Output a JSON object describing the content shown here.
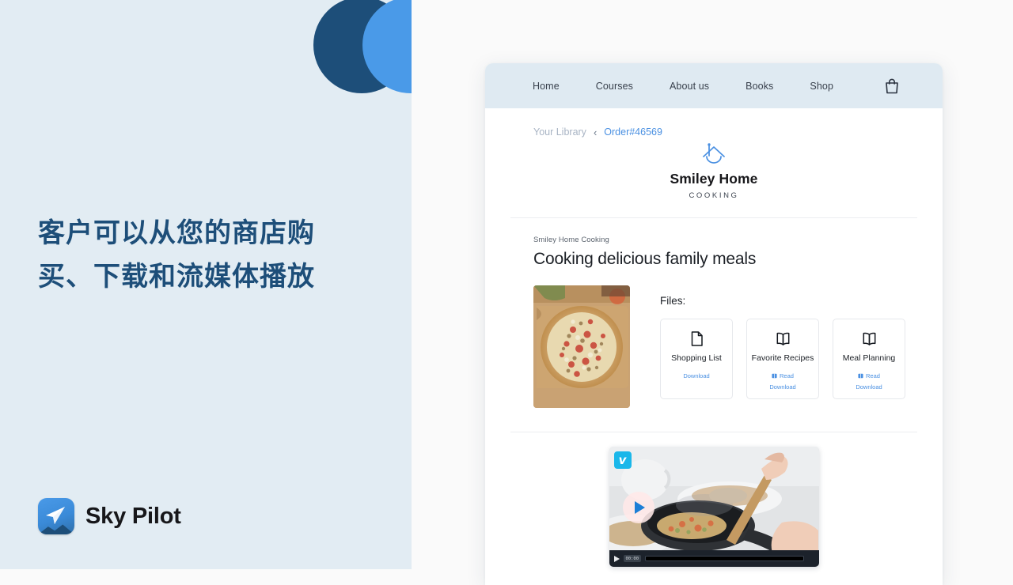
{
  "left_panel": {
    "headline": "客户可以从您的商店购买、下载和流媒体播放",
    "brand_name": "Sky Pilot",
    "logo_icon": "paper-plane-icon",
    "colors": {
      "background": "#e2ecf3",
      "headline": "#1d4e79",
      "circle_dark": "#1d4e79",
      "circle_light": "#4a9ae8"
    }
  },
  "browser": {
    "nav": {
      "items": [
        {
          "label": "Home"
        },
        {
          "label": "Courses"
        },
        {
          "label": "About us"
        },
        {
          "label": "Books"
        },
        {
          "label": "Shop"
        }
      ],
      "cart_icon": "shopping-bag-icon",
      "background": "#dfeaf2"
    },
    "breadcrumb": {
      "library": "Your Library",
      "separator": "‹",
      "order": "Order#46569",
      "order_color": "#4a90e2"
    },
    "brand": {
      "logo_icon": "house-smile-icon",
      "name": "Smiley Home",
      "tagline": "COOKING"
    },
    "product": {
      "vendor": "Smiley Home Cooking",
      "title": "Cooking delicious family meals",
      "thumbnail_alt": "pizza-on-cutting-board"
    },
    "files": {
      "label": "Files:",
      "cards": [
        {
          "name": "Shopping List",
          "icon": "document-icon",
          "links": [
            {
              "label": "Download",
              "icon": null
            }
          ]
        },
        {
          "name": "Favorite Recipes",
          "icon": "open-book-icon",
          "links": [
            {
              "label": "Read",
              "icon": "book-mini-icon"
            },
            {
              "label": "Download",
              "icon": null
            }
          ]
        },
        {
          "name": "Meal Planning",
          "icon": "open-book-icon",
          "links": [
            {
              "label": "Read",
              "icon": "book-mini-icon"
            },
            {
              "label": "Download",
              "icon": null
            }
          ]
        }
      ]
    },
    "video": {
      "provider_badge": "v",
      "provider": "vimeo",
      "badge_color": "#1ab7ea",
      "play_label": "play-button",
      "time": "00:00",
      "scene_alt": "hands-cooking-in-skillet"
    }
  }
}
